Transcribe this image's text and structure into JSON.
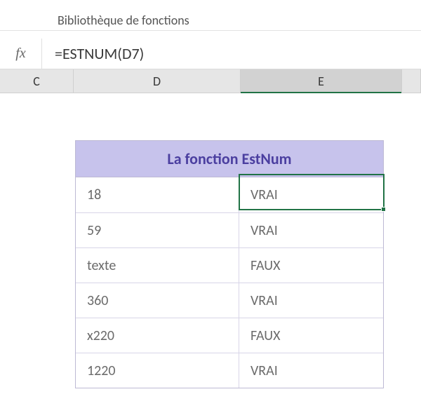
{
  "ribbon": {
    "group_label": "Bibliothèque de fonctions"
  },
  "formula_bar": {
    "fx_label": "fx",
    "formula": "=ESTNUM(D7)"
  },
  "columns": {
    "C": "C",
    "D": "D",
    "E": "E"
  },
  "table": {
    "title": "La fonction EstNum",
    "rows": [
      {
        "value": "18",
        "result": "VRAI"
      },
      {
        "value": "59",
        "result": "VRAI"
      },
      {
        "value": "texte",
        "result": "FAUX"
      },
      {
        "value": "360",
        "result": "VRAI"
      },
      {
        "value": "x220",
        "result": "FAUX"
      },
      {
        "value": "1220",
        "result": "VRAI"
      }
    ]
  },
  "colors": {
    "table_header_bg": "#c7c3ec",
    "table_header_fg": "#4b3fa0",
    "selection_green": "#217346"
  }
}
